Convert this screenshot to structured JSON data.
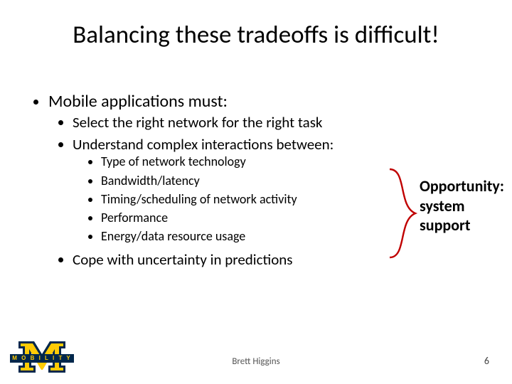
{
  "title": "Balancing these tradeoffs is difficult!",
  "bullet1": "Mobile applications must:",
  "sub1": "Select the right network for the right task",
  "sub2": "Understand complex interactions between:",
  "subsub": {
    "a": "Type of network technology",
    "b": "Bandwidth/latency",
    "c": "Timing/scheduling of network activity",
    "d": "Performance",
    "e": "Energy/data resource usage"
  },
  "sub3": "Cope with uncertainty in predictions",
  "callout": {
    "line1": "Opportunity:",
    "line2": "system",
    "line3": "support"
  },
  "footer": {
    "author": "Brett Higgins",
    "page": "6"
  },
  "logo": {
    "bar_text": "M O B I L I T Y",
    "maize": "#ffcb05",
    "blue": "#00274c"
  },
  "brace_stroke": "#c00000"
}
